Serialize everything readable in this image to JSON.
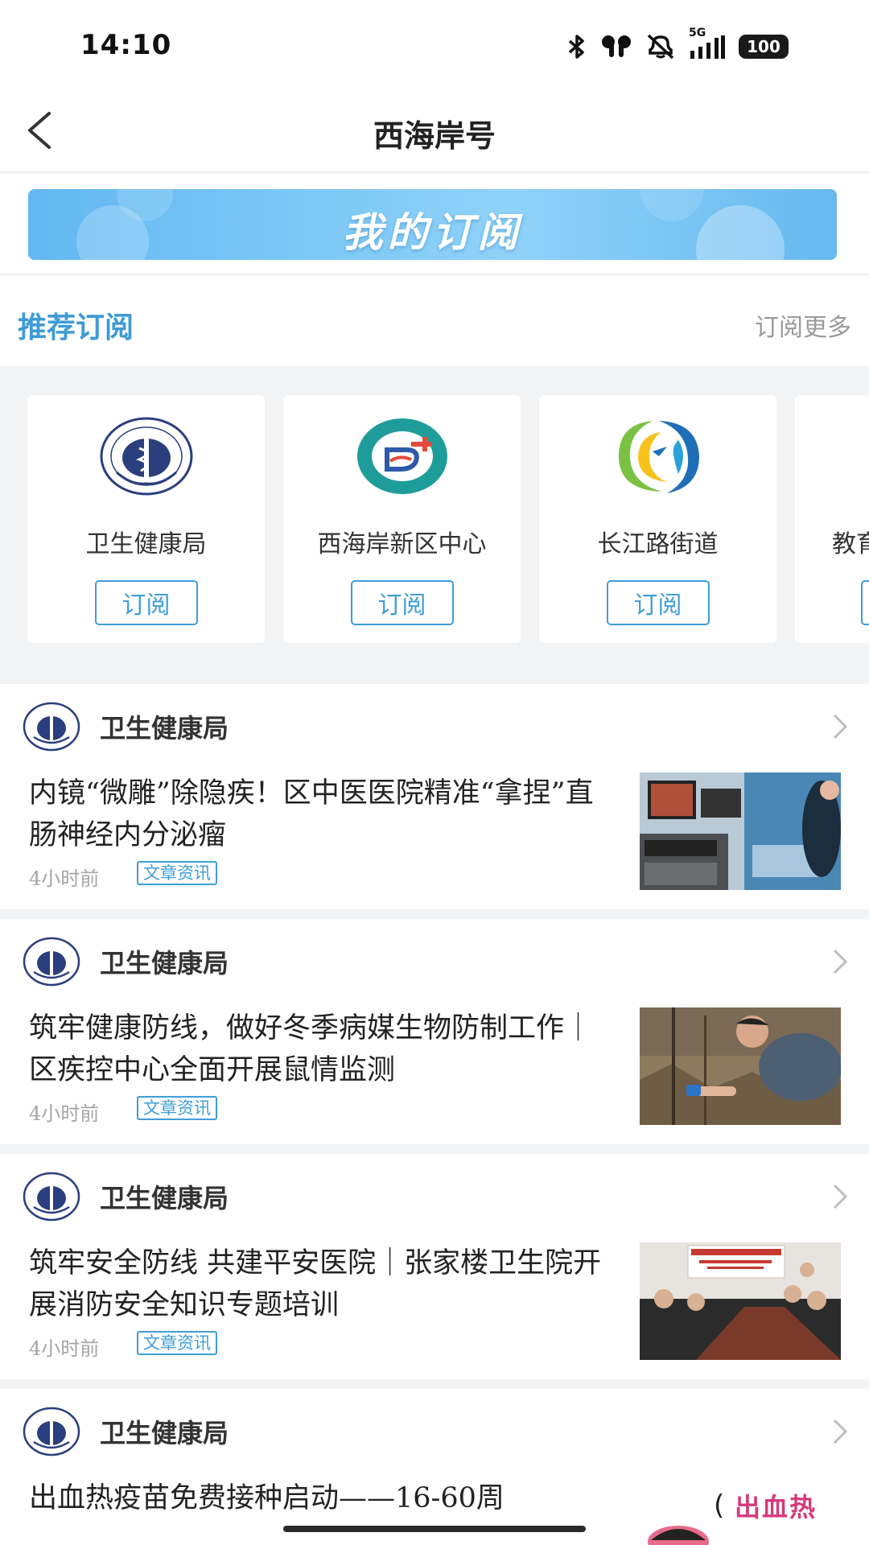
{
  "status_bar": {
    "time": "14:10",
    "network": "5G",
    "battery": "100",
    "icons": [
      "bluetooth-icon",
      "earbuds-icon",
      "mute-icon",
      "signal-icon",
      "battery-icon"
    ]
  },
  "nav": {
    "title": "西海岸号",
    "back_icon": "chevron-left-icon"
  },
  "banner": {
    "text": "我的订阅"
  },
  "recommend": {
    "title": "推荐订阅",
    "more": "订阅更多",
    "subscribe_label": "订阅",
    "cards": [
      {
        "name": "卫生健康局",
        "logo": "health-bureau-logo"
      },
      {
        "name": "西海岸新区中心",
        "logo": "district-center-logo"
      },
      {
        "name": "长江路街道",
        "logo": "changjiang-road-logo"
      },
      {
        "name": "教育",
        "logo": "education-logo"
      }
    ]
  },
  "feed": {
    "items": [
      {
        "source": "卫生健康局",
        "title": "内镜“微雕”除隐疾！区中医医院精准“拿捏”直肠神经内分泌瘤",
        "time": "4小时前",
        "tag": "文章资讯",
        "thumb": "endoscopy-room-photo"
      },
      {
        "source": "卫生健康局",
        "title": "筑牢健康防线，做好冬季病媒生物防制工作｜区疾控中心全面开展鼠情监测",
        "time": "4小时前",
        "tag": "文章资讯",
        "thumb": "field-monitoring-photo"
      },
      {
        "source": "卫生健康局",
        "title": "筑牢安全防线 共建平安医院｜张家楼卫生院开展消防安全知识专题培训",
        "time": "4小时前",
        "tag": "文章资讯",
        "thumb": "training-meeting-photo"
      },
      {
        "source": "卫生健康局",
        "title": "出血热疫苗免费接种启动——16-60周",
        "time": "",
        "tag": "",
        "thumb": "hemorrhagic-fever-cartoon",
        "thumb_text": "出血热"
      }
    ]
  },
  "colors": {
    "accent": "#3f9ed8",
    "title_blue": "#3e9bd6",
    "muted": "#9a9a9a",
    "strip_bg": "#f2f3f5"
  }
}
